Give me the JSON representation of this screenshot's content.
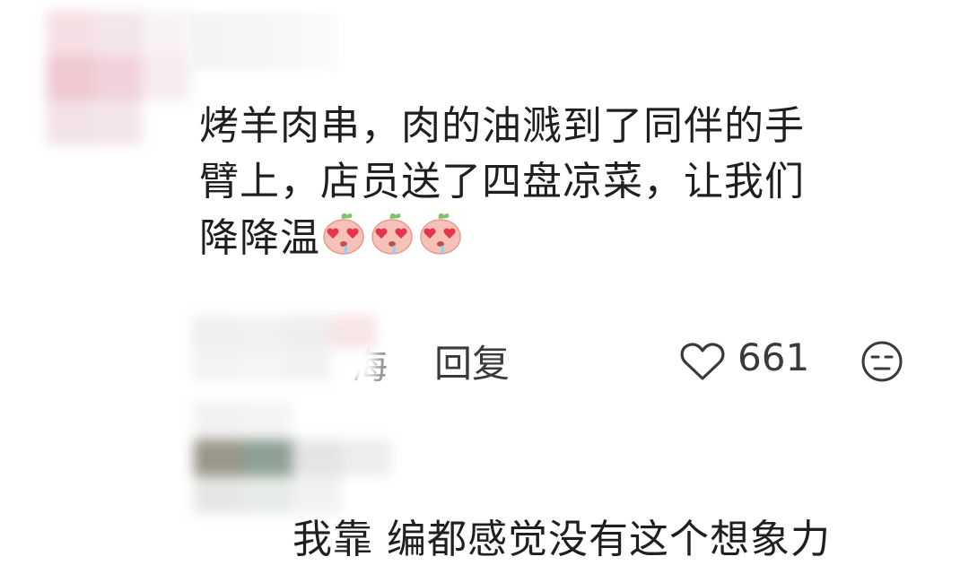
{
  "comment": {
    "text_line1": "烤羊肉串，肉的油溅到了同伴的手",
    "text_line2": "臂上，店员送了四盘凉菜，让我们",
    "text_line3": "降降温",
    "emoji_icons": [
      "peach-heart-eyes-icon",
      "peach-heart-eyes-icon",
      "peach-heart-eyes-icon"
    ],
    "location_partial": "海",
    "reply_label": "回复",
    "like_count": "661"
  },
  "reply": {
    "text": "我靠 编都感觉没有这个想象力"
  },
  "colors": {
    "text": "#1f1f1f",
    "meta_text": "#8a8a8a",
    "icon_stroke": "#3a3a3a",
    "emoji_pink": "#f4b8b0",
    "emoji_heart": "#e8344a"
  }
}
